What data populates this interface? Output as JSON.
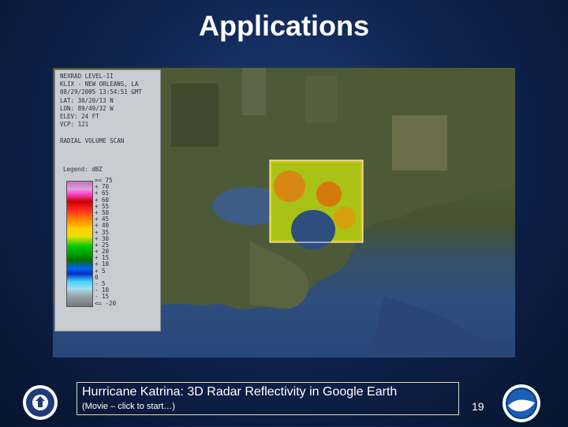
{
  "slide": {
    "title": "Applications",
    "page_number": "19"
  },
  "radar_info": {
    "lines": [
      "NEXRAD LEVEL-II",
      "KLIX - NEW ORLEANS, LA",
      "08/29/2005 13:54:51 GMT",
      "LAT: 30/20/13 N",
      "LON: 89/49/32 W",
      "ELEV: 24 FT",
      "VCP: 121",
      "",
      "RADIAL VOLUME SCAN"
    ],
    "legend_title": "Legend: dBZ",
    "legend_labels": [
      ">= 75",
      "+ 70",
      "+ 65",
      "+ 60",
      "+ 55",
      "+ 50",
      "+ 45",
      "+ 40",
      "+ 35",
      "+ 30",
      "+ 25",
      "+ 20",
      "+ 15",
      "+ 10",
      "+ 5",
      "0",
      "- 5",
      "- 10",
      "- 15",
      "<= -20"
    ]
  },
  "caption": {
    "main": "Hurricane Katrina: 3D Radar Reflectivity in Google Earth",
    "sub": "(Movie – click to start…)"
  },
  "icons": {
    "left_seal": "doc-seal-icon",
    "right_seal": "noaa-logo-icon"
  }
}
